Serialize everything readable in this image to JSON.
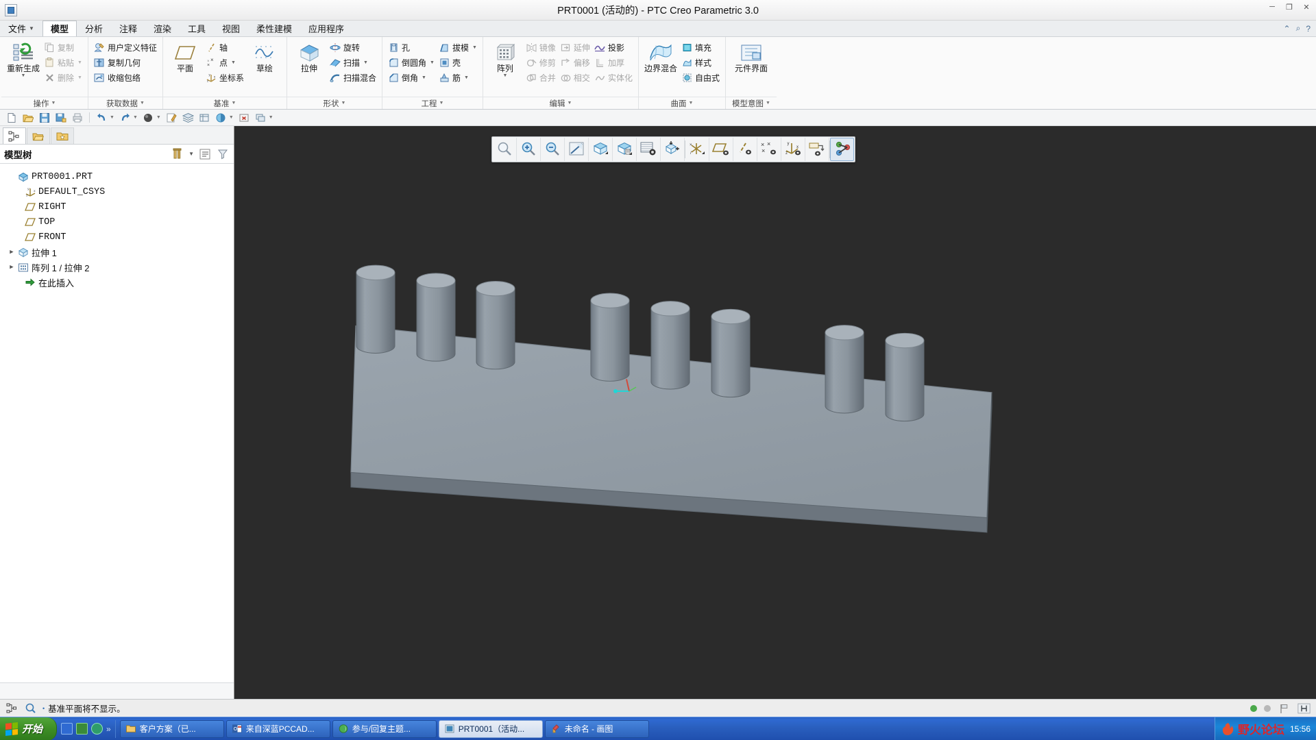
{
  "window": {
    "title": "PRT0001 (活动的) - PTC Creo Parametric 3.0",
    "minimize": "─",
    "maximize": "❐",
    "close": "✕"
  },
  "ribbon": {
    "tabs": [
      {
        "label": "文件",
        "active": false,
        "has_caret": true
      },
      {
        "label": "模型",
        "active": true,
        "has_caret": false
      },
      {
        "label": "分析",
        "active": false,
        "has_caret": false
      },
      {
        "label": "注释",
        "active": false,
        "has_caret": false
      },
      {
        "label": "渲染",
        "active": false,
        "has_caret": false
      },
      {
        "label": "工具",
        "active": false,
        "has_caret": false
      },
      {
        "label": "视图",
        "active": false,
        "has_caret": false
      },
      {
        "label": "柔性建模",
        "active": false,
        "has_caret": false
      },
      {
        "label": "应用程序",
        "active": false,
        "has_caret": false
      }
    ],
    "groups": {
      "operations": {
        "label": "操作",
        "regenerate": "重新生成",
        "copy": "复制",
        "paste": "粘贴",
        "delete": "删除"
      },
      "get_data": {
        "label": "获取数据",
        "udf": "用户定义特征",
        "copy_geometry": "复制几何",
        "shrinkwrap": "收缩包络"
      },
      "datum": {
        "label": "基准",
        "plane": "平面",
        "axis": "轴",
        "point": "点",
        "csys": "坐标系",
        "sketch": "草绘"
      },
      "shapes": {
        "label": "形状",
        "extrude": "拉伸",
        "revolve": "旋转",
        "sweep": "扫描",
        "swept_blend": "扫描混合"
      },
      "engineering": {
        "label": "工程",
        "hole": "孔",
        "round": "倒圆角",
        "chamfer": "倒角",
        "draft": "拔模",
        "shell": "壳",
        "rib": "筋"
      },
      "editing": {
        "label": "编辑",
        "pattern": "阵列",
        "mirror": "镜像",
        "trim": "修剪",
        "merge": "合并",
        "extend": "延伸",
        "offset": "偏移",
        "intersect": "相交",
        "project": "投影",
        "thicken": "加厚",
        "solidify": "实体化"
      },
      "surfaces": {
        "label": "曲面",
        "boundary_blend": "边界混合",
        "fill": "填充",
        "style": "样式",
        "freestyle": "自由式"
      },
      "model_intent": {
        "label": "模型意图",
        "component_interface": "元件界面"
      }
    }
  },
  "quickbar": {
    "items": [
      {
        "name": "new-file-icon"
      },
      {
        "name": "open-file-icon"
      },
      {
        "name": "save-icon"
      },
      {
        "name": "save-as-icon"
      },
      {
        "name": "print-icon"
      },
      {
        "name": "undo-icon"
      },
      {
        "name": "redo-icon"
      },
      {
        "name": "regenerate-icon"
      },
      {
        "name": "annotate-icon"
      },
      {
        "name": "layers-icon"
      },
      {
        "name": "view-manager-icon"
      },
      {
        "name": "appearance-icon"
      },
      {
        "name": "close-window-icon"
      },
      {
        "name": "window-list-icon"
      }
    ]
  },
  "navigator": {
    "tabs": [
      {
        "name": "model-tree-tab",
        "active": true
      },
      {
        "name": "folder-browser-tab",
        "active": false
      },
      {
        "name": "favorites-tab",
        "active": false
      }
    ],
    "header": {
      "title": "模型树",
      "settings_icon": "tools-icon",
      "display_icon": "list-display-icon",
      "filter_icon": "filter-icon"
    },
    "tree": [
      {
        "label": "PRT0001.PRT",
        "icon": "part-icon",
        "indent": 0,
        "expander": "",
        "cjk": false
      },
      {
        "label": "DEFAULT_CSYS",
        "icon": "csys-icon",
        "indent": 1,
        "expander": "",
        "cjk": false
      },
      {
        "label": "RIGHT",
        "icon": "plane-icon",
        "indent": 1,
        "expander": "",
        "cjk": false
      },
      {
        "label": "TOP",
        "icon": "plane-icon",
        "indent": 1,
        "expander": "",
        "cjk": false
      },
      {
        "label": "FRONT",
        "icon": "plane-icon",
        "indent": 1,
        "expander": "",
        "cjk": false
      },
      {
        "label": "拉伸 1",
        "icon": "extrude-feature-icon",
        "indent": 0,
        "expander": "▶",
        "cjk": true
      },
      {
        "label": "阵列 1 / 拉伸 2",
        "icon": "pattern-feature-icon",
        "indent": 0,
        "expander": "▶",
        "cjk": true
      },
      {
        "label": "在此插入",
        "icon": "insert-here-icon",
        "indent": 1,
        "expander": "",
        "cjk": true
      }
    ]
  },
  "graphics_toolbar": {
    "buttons": [
      {
        "name": "refit-icon",
        "selected": false
      },
      {
        "name": "zoom-in-icon",
        "selected": false
      },
      {
        "name": "zoom-out-icon",
        "selected": false
      },
      {
        "name": "repaint-icon",
        "selected": false
      },
      {
        "name": "display-style-shaded-icon",
        "selected": false
      },
      {
        "name": "display-style-hidden-icon",
        "selected": false
      },
      {
        "name": "saved-views-icon",
        "selected": false
      },
      {
        "name": "view-normal-icon",
        "selected": false
      },
      {
        "name": "datum-display-filters-icon",
        "selected": false
      },
      {
        "name": "plane-display-icon",
        "selected": false
      },
      {
        "name": "axis-display-icon",
        "selected": false
      },
      {
        "name": "point-display-icon",
        "selected": false
      },
      {
        "name": "csys-display-icon",
        "selected": false
      },
      {
        "name": "annotation-display-icon",
        "selected": false
      },
      {
        "name": "spin-center-icon",
        "selected": true
      }
    ]
  },
  "viewport": {
    "model": {
      "description": "矩形板上的圆柱阵列",
      "cylinder_count": 8,
      "body_color": "#8a939c",
      "top_face_color": "#9aa3ac",
      "side_face_color": "#6f7880",
      "background_color": "#2b2b2b"
    },
    "csys_marker": {
      "x_label": "",
      "y_label": "",
      "z_label": ""
    }
  },
  "statusbar": {
    "message": "基准平面将不显示。",
    "bullet": "•",
    "left_icons": [
      "model-tree-toggle-icon",
      "search-icon"
    ],
    "right_icons": [
      "status-green-dot",
      "status-gray-dot",
      "flag-icon",
      "selection-filter-icon"
    ]
  },
  "taskbar": {
    "start": "开始",
    "quicklaunch_more": "»",
    "items": [
      {
        "label": "客户方案（已...",
        "icon": "folder-icon",
        "active": false
      },
      {
        "label": "来自深蓝PCCAD...",
        "icon": "outlook-icon",
        "active": false
      },
      {
        "label": "参与/回复主题...",
        "icon": "browser-icon",
        "active": false
      },
      {
        "label": "PRT0001（活动...",
        "icon": "creo-icon",
        "active": true
      },
      {
        "label": "未命名 - 画图",
        "icon": "paint-icon",
        "active": false
      }
    ],
    "tray": {
      "clock": "15:56",
      "watermark": "野火论坛",
      "small_text": "野火"
    }
  }
}
